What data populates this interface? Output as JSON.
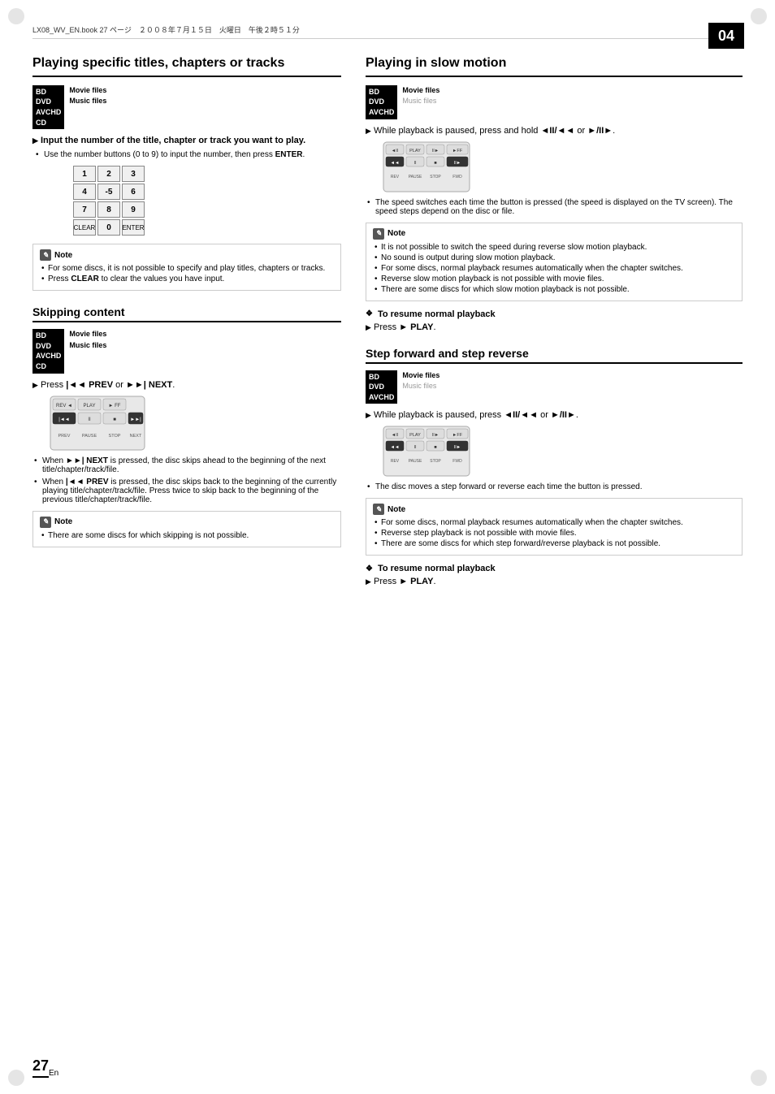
{
  "header": {
    "text": "LX08_WV_EN.book  27  ページ　２００８年７月１５日　火曜日　午後２時５１分"
  },
  "chapter_badge": "04",
  "page_number": "27",
  "page_lang": "En",
  "left_section": {
    "title": "Playing specific titles, chapters or tracks",
    "disc_labels": [
      "BD",
      "DVD",
      "AVCHD",
      "CD"
    ],
    "file_labels": [
      "Movie files",
      "Music files"
    ],
    "instruction1": "Input the number of the title, chapter or track you want to play.",
    "sub1": "Use the number buttons (0 to 9) to input the number, then press ENTER.",
    "keypad": [
      "1",
      "2",
      "3",
      "4",
      "-5",
      "6",
      "7",
      "8",
      "9",
      "CLEAR",
      "0",
      "ENTER"
    ],
    "note_title": "Note",
    "notes_left": [
      "For some discs, it is not possible to specify and play titles, chapters or tracks.",
      "Press CLEAR to clear the values you have input."
    ],
    "skipping_title": "Skipping content",
    "skip_disc_labels": [
      "BD",
      "DVD",
      "AVCHD",
      "CD"
    ],
    "skip_file_labels": [
      "Movie files",
      "Music files"
    ],
    "skip_instruction": "Press |◄◄ PREV or ►►| NEXT.",
    "skip_notes": [
      "When ►►| NEXT is pressed, the disc skips ahead to the beginning of the next title/chapter/track/file.",
      "When |◄◄ PREV is pressed, the disc skips back to the beginning of the currently playing title/chapter/track/file. Press twice to skip back to the beginning of the previous title/chapter/track/file."
    ],
    "skip_note_title": "Note",
    "skip_note_items": [
      "There are some discs for which skipping is not possible."
    ]
  },
  "right_section": {
    "title": "Playing in slow motion",
    "disc_labels": [
      "BD",
      "DVD",
      "AVCHD"
    ],
    "file_labels_active": "Movie files",
    "file_labels_inactive": "Music files",
    "slow_instruction": "While playback is paused, press and hold ◄II/◄◄ or ►/II►.",
    "slow_notes": [
      "The speed switches each time the button is pressed (the speed is displayed on the TV screen). The speed steps depend on the disc or file."
    ],
    "note_title": "Note",
    "slow_note_items": [
      "It is not possible to switch the speed during reverse slow motion playback.",
      "No sound is output during slow motion playback.",
      "For some discs, normal playback resumes automatically when the chapter switches.",
      "Reverse slow motion playback is not possible with movie files.",
      "There are some discs for which slow motion playback is not possible."
    ],
    "resume1_title": "To resume normal playback",
    "resume1_instruction": "Press ► PLAY.",
    "step_title": "Step forward and step reverse",
    "step_disc_labels": [
      "BD",
      "DVD",
      "AVCHD"
    ],
    "step_file_labels_active": "Movie files",
    "step_file_labels_inactive": "Music files",
    "step_instruction": "While playback is paused, press ◄II/◄◄ or ►/II►.",
    "step_note_title": "Note",
    "step_note_items": [
      "The disc moves a step forward or reverse each time the button is pressed."
    ],
    "step_notes2": [
      "For some discs, normal playback resumes automatically when the chapter switches.",
      "Reverse step playback is not possible with movie files.",
      "There are some discs for which step forward/reverse playback is not possible."
    ],
    "resume2_title": "To resume normal playback",
    "resume2_instruction": "Press ► PLAY."
  }
}
